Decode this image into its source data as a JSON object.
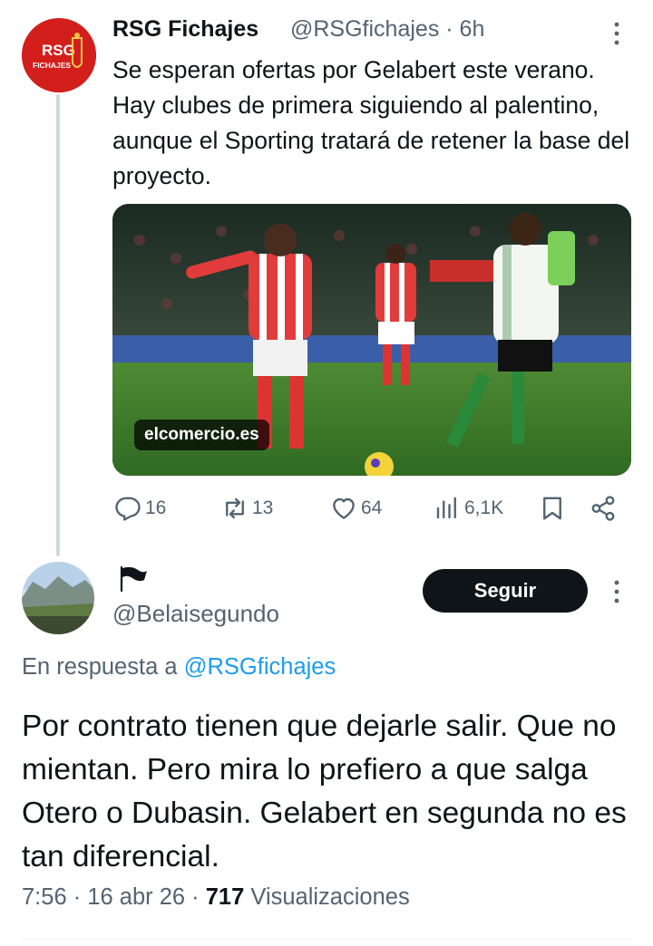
{
  "parent_tweet": {
    "avatar_text_line1": "RSG",
    "avatar_text_line2": "FICHAJES",
    "display_name": "RSG Fichajes",
    "handle_time": "@RSGfichajes · 6h",
    "text": "Se esperan ofertas por Gelabert este verano. Hay clubes de primera siguiendo al palentino, aunque el Sporting tratará de retener la base del proyecto.",
    "media_source": "elcomercio.es",
    "stats": {
      "replies": "16",
      "retweets": "13",
      "likes": "64",
      "views": "6,1K"
    }
  },
  "reply_tweet": {
    "handle": "@Belaisegundo",
    "follow_label": "Seguir",
    "in_reply_prefix": "En respuesta a ",
    "in_reply_mention": "@RSGfichajes",
    "text": "Por contrato tienen que dejarle salir. Que no mientan. Pero mira lo prefiero a que salga Otero o Dubasin. Gelabert en segunda no es tan diferencial.",
    "time": "7:56",
    "date": "16 abr 26",
    "views_count": "717",
    "views_label": "Visualizaciones"
  },
  "icons": [
    "reply-icon",
    "retweet-icon",
    "like-icon",
    "views-icon",
    "bookmark-icon",
    "share-icon",
    "more-icon",
    "flag-icon"
  ],
  "colors": {
    "text": "#0f1419",
    "secondary": "#536471",
    "link": "#1d9bf0",
    "thread_line": "#cfd9de",
    "avatar_red": "#d21f1b"
  }
}
